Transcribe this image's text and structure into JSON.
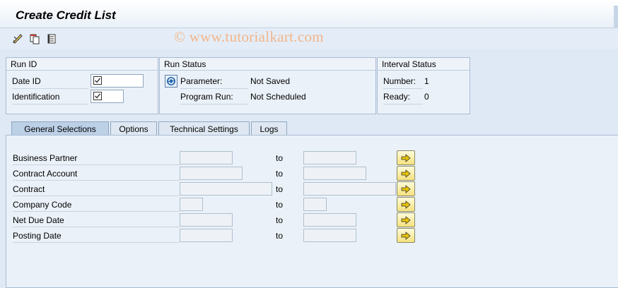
{
  "window": {
    "title": "Create Credit List"
  },
  "toolbar": {
    "icons": [
      "edit-pencil-icon",
      "copy-icon",
      "variant-list-icon"
    ]
  },
  "watermark": "© www.tutorialkart.com",
  "run_id": {
    "title": "Run ID",
    "date_id_label": "Date ID",
    "identification_label": "Identification"
  },
  "run_status": {
    "title": "Run Status",
    "parameter_label": "Parameter:",
    "parameter_value": "Not Saved",
    "program_run_label": "Program Run:",
    "program_run_value": "Not Scheduled"
  },
  "interval_status": {
    "title": "Interval Status",
    "number_label": "Number:",
    "number_value": "1",
    "ready_label": "Ready:",
    "ready_value": "0"
  },
  "tabs": [
    {
      "label": "General Selections",
      "active": true
    },
    {
      "label": "Options",
      "active": false
    },
    {
      "label": "Technical Settings",
      "active": false
    },
    {
      "label": "Logs",
      "active": false
    }
  ],
  "selections": {
    "to_label": "to",
    "rows": [
      {
        "label": "Business Partner",
        "from": "",
        "to": ""
      },
      {
        "label": "Contract Account",
        "from": "",
        "to": ""
      },
      {
        "label": "Contract",
        "from": "",
        "to": ""
      },
      {
        "label": "Company Code",
        "from": "",
        "to": ""
      },
      {
        "label": "Net Due Date",
        "from": "",
        "to": ""
      },
      {
        "label": "Posting Date",
        "from": "",
        "to": ""
      }
    ]
  }
}
